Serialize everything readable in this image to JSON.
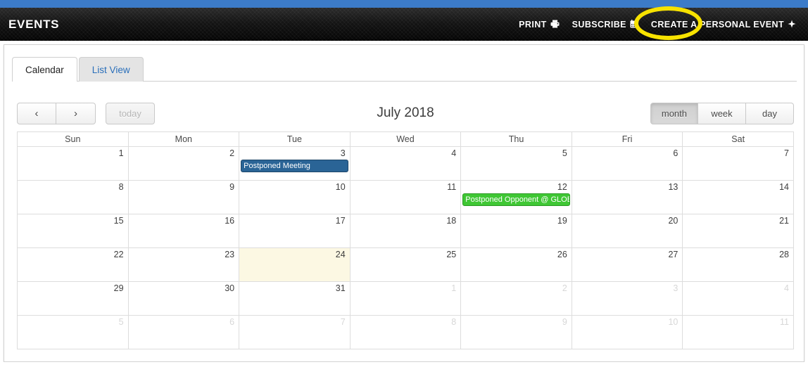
{
  "header": {
    "brand": "EVENTS",
    "actions": [
      {
        "label": "PRINT",
        "icon": "printer-icon",
        "glyph": "⎙"
      },
      {
        "label": "SUBSCRIBE",
        "icon": "calendar-icon",
        "glyph": "Ὄ5"
      },
      {
        "label": "CREATE A PERSONAL EVENT",
        "icon": "plus-icon",
        "glyph": "✦"
      }
    ],
    "annotation": {
      "shape": "ellipse",
      "color": "#f7e200",
      "targets": "SUBSCRIBE"
    }
  },
  "tabs": [
    {
      "label": "Calendar",
      "active": true
    },
    {
      "label": "List View",
      "active": false
    }
  ],
  "toolbar": {
    "prev_label": "‹",
    "next_label": "›",
    "today_label": "today",
    "title": "July 2018",
    "views": [
      {
        "label": "month",
        "active": true
      },
      {
        "label": "week",
        "active": false
      },
      {
        "label": "day",
        "active": false
      }
    ]
  },
  "calendar": {
    "day_headers": [
      "Sun",
      "Mon",
      "Tue",
      "Wed",
      "Thu",
      "Fri",
      "Sat"
    ],
    "weeks": [
      [
        {
          "day": "1",
          "other": false,
          "today": false,
          "events": []
        },
        {
          "day": "2",
          "other": false,
          "today": false,
          "events": []
        },
        {
          "day": "3",
          "other": false,
          "today": false,
          "events": [
            {
              "title": "Postponed Meeting",
              "color": "blue"
            }
          ]
        },
        {
          "day": "4",
          "other": false,
          "today": false,
          "events": []
        },
        {
          "day": "5",
          "other": false,
          "today": false,
          "events": []
        },
        {
          "day": "6",
          "other": false,
          "today": false,
          "events": []
        },
        {
          "day": "7",
          "other": false,
          "today": false,
          "events": []
        }
      ],
      [
        {
          "day": "8",
          "other": false,
          "today": false,
          "events": []
        },
        {
          "day": "9",
          "other": false,
          "today": false,
          "events": []
        },
        {
          "day": "10",
          "other": false,
          "today": false,
          "events": []
        },
        {
          "day": "11",
          "other": false,
          "today": false,
          "events": []
        },
        {
          "day": "12",
          "other": false,
          "today": false,
          "events": [
            {
              "title": "Postponed Opponent @ GLOBAL",
              "color": "green"
            }
          ]
        },
        {
          "day": "13",
          "other": false,
          "today": false,
          "events": []
        },
        {
          "day": "14",
          "other": false,
          "today": false,
          "events": []
        }
      ],
      [
        {
          "day": "15",
          "other": false,
          "today": false,
          "events": []
        },
        {
          "day": "16",
          "other": false,
          "today": false,
          "events": []
        },
        {
          "day": "17",
          "other": false,
          "today": false,
          "events": []
        },
        {
          "day": "18",
          "other": false,
          "today": false,
          "events": []
        },
        {
          "day": "19",
          "other": false,
          "today": false,
          "events": []
        },
        {
          "day": "20",
          "other": false,
          "today": false,
          "events": []
        },
        {
          "day": "21",
          "other": false,
          "today": false,
          "events": []
        }
      ],
      [
        {
          "day": "22",
          "other": false,
          "today": false,
          "events": []
        },
        {
          "day": "23",
          "other": false,
          "today": false,
          "events": []
        },
        {
          "day": "24",
          "other": false,
          "today": true,
          "events": []
        },
        {
          "day": "25",
          "other": false,
          "today": false,
          "events": []
        },
        {
          "day": "26",
          "other": false,
          "today": false,
          "events": []
        },
        {
          "day": "27",
          "other": false,
          "today": false,
          "events": []
        },
        {
          "day": "28",
          "other": false,
          "today": false,
          "events": []
        }
      ],
      [
        {
          "day": "29",
          "other": false,
          "today": false,
          "events": []
        },
        {
          "day": "30",
          "other": false,
          "today": false,
          "events": []
        },
        {
          "day": "31",
          "other": false,
          "today": false,
          "events": []
        },
        {
          "day": "1",
          "other": true,
          "today": false,
          "events": []
        },
        {
          "day": "2",
          "other": true,
          "today": false,
          "events": []
        },
        {
          "day": "3",
          "other": true,
          "today": false,
          "events": []
        },
        {
          "day": "4",
          "other": true,
          "today": false,
          "events": []
        }
      ],
      [
        {
          "day": "5",
          "other": true,
          "today": false,
          "events": []
        },
        {
          "day": "6",
          "other": true,
          "today": false,
          "events": []
        },
        {
          "day": "7",
          "other": true,
          "today": false,
          "events": []
        },
        {
          "day": "8",
          "other": true,
          "today": false,
          "events": []
        },
        {
          "day": "9",
          "other": true,
          "today": false,
          "events": []
        },
        {
          "day": "10",
          "other": true,
          "today": false,
          "events": []
        },
        {
          "day": "11",
          "other": true,
          "today": false,
          "events": []
        }
      ]
    ]
  },
  "colors": {
    "accent_blue": "#3c7bc8",
    "event_blue": "#2a6496",
    "event_green": "#3fc734",
    "today_bg": "#fcf8e3",
    "annotation_yellow": "#f7e200"
  }
}
